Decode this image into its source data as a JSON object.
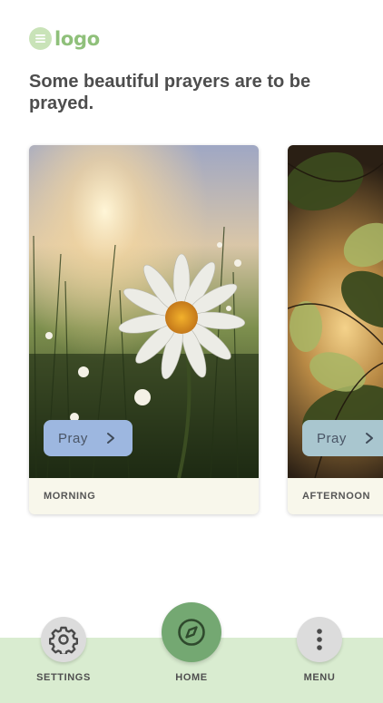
{
  "logo": {
    "text": "logo",
    "icon": "list-icon"
  },
  "headline": "Some beautiful prayers are to be prayed.",
  "cards": [
    {
      "label": "MORNING",
      "button_label": "Pray",
      "button_icon": "chevron-right-icon",
      "image": "daisy-field-sunrise",
      "button_color": "#9db7e0"
    },
    {
      "label": "AFTERNOON",
      "button_label": "Pray",
      "button_icon": "chevron-right-icon",
      "image": "sunlit-leaves",
      "button_color": "#a9c6cf"
    }
  ],
  "nav": {
    "settings": {
      "label": "SETTINGS",
      "icon": "gear-icon"
    },
    "home": {
      "label": "HOME",
      "icon": "compass-icon"
    },
    "menu": {
      "label": "MENU",
      "icon": "more-vertical-icon"
    }
  },
  "colors": {
    "accent": "#74a872",
    "nav_background": "#d9ecd0",
    "logo": "#8fc07a",
    "card_footer": "#f8f7eb"
  }
}
